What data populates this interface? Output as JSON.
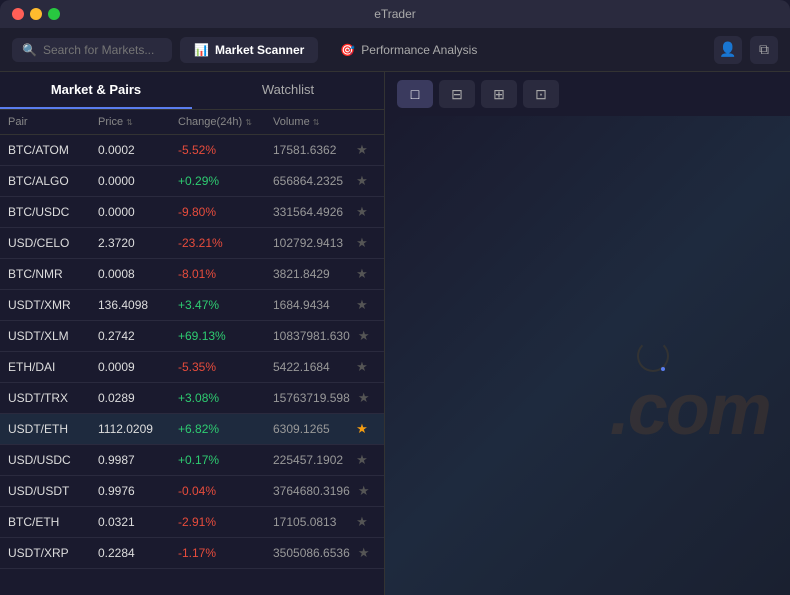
{
  "window": {
    "title": "eTrader"
  },
  "titlebar": {
    "title": "eTrader"
  },
  "nav": {
    "search_placeholder": "Search for Markets...",
    "tabs": [
      {
        "id": "market-scanner",
        "label": "Market Scanner",
        "icon": "📊",
        "active": true
      },
      {
        "id": "performance-analysis",
        "label": "Performance Analysis",
        "icon": "🎯",
        "active": false
      }
    ]
  },
  "leftPanel": {
    "tabs": [
      {
        "id": "market-pairs",
        "label": "Market & Pairs",
        "active": true
      },
      {
        "id": "watchlist",
        "label": "Watchlist",
        "active": false
      }
    ],
    "tableHeaders": {
      "pair": "Pair",
      "price": "Price",
      "change": "Change(24h)",
      "volume": "Volume"
    },
    "rows": [
      {
        "pair": "BTC/ATOM",
        "price": "0.0002",
        "change": "-5.52%",
        "changeType": "neg",
        "volume": "17581.6362",
        "starred": false
      },
      {
        "pair": "BTC/ALGO",
        "price": "0.0000",
        "change": "+0.29%",
        "changeType": "pos",
        "volume": "656864.2325",
        "starred": false
      },
      {
        "pair": "BTC/USDC",
        "price": "0.0000",
        "change": "-9.80%",
        "changeType": "neg",
        "volume": "331564.4926",
        "starred": false
      },
      {
        "pair": "USD/CELO",
        "price": "2.3720",
        "change": "-23.21%",
        "changeType": "neg",
        "volume": "102792.9413",
        "starred": false
      },
      {
        "pair": "BTC/NMR",
        "price": "0.0008",
        "change": "-8.01%",
        "changeType": "neg",
        "volume": "3821.8429",
        "starred": false
      },
      {
        "pair": "USDT/XMR",
        "price": "136.4098",
        "change": "+3.47%",
        "changeType": "pos",
        "volume": "1684.9434",
        "starred": false
      },
      {
        "pair": "USDT/XLM",
        "price": "0.2742",
        "change": "+69.13%",
        "changeType": "pos",
        "volume": "10837981.630",
        "starred": false
      },
      {
        "pair": "ETH/DAI",
        "price": "0.0009",
        "change": "-5.35%",
        "changeType": "neg",
        "volume": "5422.1684",
        "starred": false
      },
      {
        "pair": "USDT/TRX",
        "price": "0.0289",
        "change": "+3.08%",
        "changeType": "pos",
        "volume": "15763719.598",
        "starred": false
      },
      {
        "pair": "USDT/ETH",
        "price": "1112.0209",
        "change": "+6.82%",
        "changeType": "pos",
        "volume": "6309.1265",
        "starred": true
      },
      {
        "pair": "USD/USDC",
        "price": "0.9987",
        "change": "+0.17%",
        "changeType": "pos",
        "volume": "225457.1902",
        "starred": false
      },
      {
        "pair": "USD/USDT",
        "price": "0.9976",
        "change": "-0.04%",
        "changeType": "neg",
        "volume": "3764680.3196",
        "starred": false
      },
      {
        "pair": "BTC/ETH",
        "price": "0.0321",
        "change": "-2.91%",
        "changeType": "neg",
        "volume": "17105.0813",
        "starred": false
      },
      {
        "pair": "USDT/XRP",
        "price": "0.2284",
        "change": "-1.17%",
        "changeType": "neg",
        "volume": "3505086.6536",
        "starred": false
      }
    ]
  },
  "rightPanel": {
    "layoutButtons": [
      {
        "id": "single",
        "icon": "□",
        "active": true
      },
      {
        "id": "split-h",
        "icon": "⊟",
        "active": false
      },
      {
        "id": "quad",
        "icon": "⊞",
        "active": false
      },
      {
        "id": "quad-alt",
        "icon": "⊡",
        "active": false
      }
    ],
    "watermark": ".com",
    "loading": true
  }
}
